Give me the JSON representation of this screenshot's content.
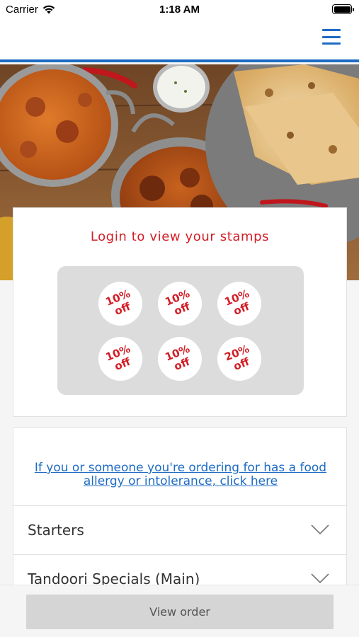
{
  "status_bar": {
    "carrier": "Carrier",
    "time": "1:18 AM"
  },
  "colors": {
    "accent": "#1d6bc4",
    "stamp_red": "#d21d26",
    "panel_grey": "#dcdcdc"
  },
  "header": {
    "menu_icon": "hamburger-menu-icon"
  },
  "stamps": {
    "title": "Login to view your stamps",
    "items": [
      {
        "line1": "10%",
        "line2": "off"
      },
      {
        "line1": "10%",
        "line2": "off"
      },
      {
        "line1": "10%",
        "line2": "off"
      },
      {
        "line1": "10%",
        "line2": "off"
      },
      {
        "line1": "10%",
        "line2": "off"
      },
      {
        "line1": "20%",
        "line2": "off"
      }
    ]
  },
  "menu": {
    "allergy_link": "If you or someone you're ordering for has a food allergy or intolerance, click here",
    "categories": [
      {
        "label": "Starters",
        "icon": "chevron-down-icon"
      },
      {
        "label": "Tandoori Specials (Main)",
        "icon": "chevron-down-icon"
      }
    ]
  },
  "footer": {
    "view_order_label": "View order"
  }
}
